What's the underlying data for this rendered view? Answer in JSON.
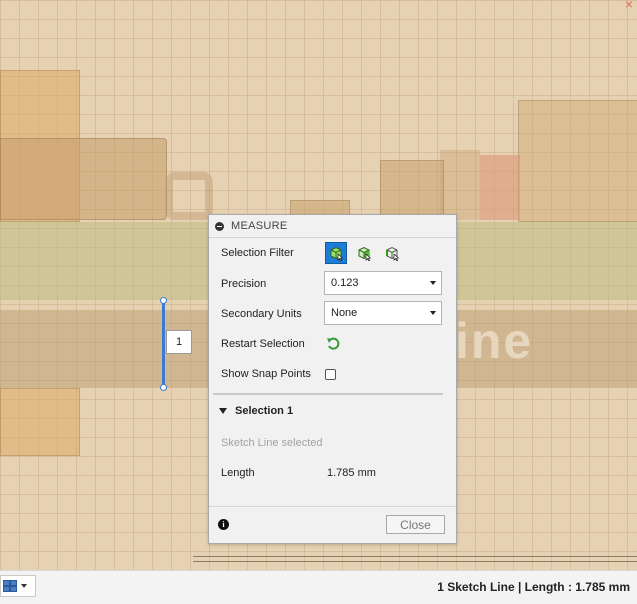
{
  "panel": {
    "title": "MEASURE",
    "selection_filter_label": "Selection Filter",
    "precision_label": "Precision",
    "precision_value": "0.123",
    "secondary_units_label": "Secondary Units",
    "secondary_units_value": "None",
    "restart_selection_label": "Restart Selection",
    "show_snap_points_label": "Show Snap Points",
    "show_snap_points_checked": false,
    "section_title": "Selection 1",
    "selection_info": "Sketch Line selected",
    "length_label": "Length",
    "length_value": "1.785 mm",
    "close_label": "Close"
  },
  "canvas": {
    "callout_label": "1",
    "background_lettering": "ine",
    "selection_color": "#3b7bd6"
  },
  "status": {
    "text": "1 Sketch Line | Length : 1.785 mm"
  },
  "colors": {
    "accent": "#1e7bd6",
    "restart_icon": "#3a9a3a"
  }
}
